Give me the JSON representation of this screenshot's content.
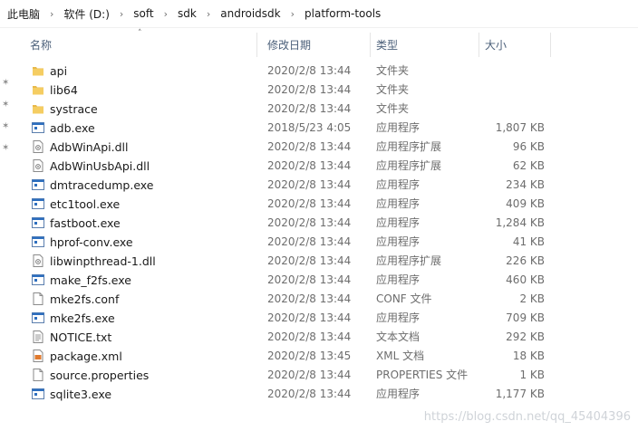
{
  "breadcrumb": [
    "此电脑",
    "软件 (D:)",
    "soft",
    "sdk",
    "androidsdk",
    "platform-tools"
  ],
  "columns": {
    "name": "名称",
    "date": "修改日期",
    "type": "类型",
    "size": "大小"
  },
  "files": [
    {
      "icon": "folder-icon",
      "name": "api",
      "date": "2020/2/8 13:44",
      "type": "文件夹",
      "size": ""
    },
    {
      "icon": "folder-icon",
      "name": "lib64",
      "date": "2020/2/8 13:44",
      "type": "文件夹",
      "size": ""
    },
    {
      "icon": "folder-icon",
      "name": "systrace",
      "date": "2020/2/8 13:44",
      "type": "文件夹",
      "size": ""
    },
    {
      "icon": "exe-icon",
      "name": "adb.exe",
      "date": "2018/5/23 4:05",
      "type": "应用程序",
      "size": "1,807 KB"
    },
    {
      "icon": "dll-icon",
      "name": "AdbWinApi.dll",
      "date": "2020/2/8 13:44",
      "type": "应用程序扩展",
      "size": "96 KB"
    },
    {
      "icon": "dll-icon",
      "name": "AdbWinUsbApi.dll",
      "date": "2020/2/8 13:44",
      "type": "应用程序扩展",
      "size": "62 KB"
    },
    {
      "icon": "exe-icon",
      "name": "dmtracedump.exe",
      "date": "2020/2/8 13:44",
      "type": "应用程序",
      "size": "234 KB"
    },
    {
      "icon": "exe-icon",
      "name": "etc1tool.exe",
      "date": "2020/2/8 13:44",
      "type": "应用程序",
      "size": "409 KB"
    },
    {
      "icon": "exe-icon",
      "name": "fastboot.exe",
      "date": "2020/2/8 13:44",
      "type": "应用程序",
      "size": "1,284 KB"
    },
    {
      "icon": "exe-icon",
      "name": "hprof-conv.exe",
      "date": "2020/2/8 13:44",
      "type": "应用程序",
      "size": "41 KB"
    },
    {
      "icon": "dll-icon",
      "name": "libwinpthread-1.dll",
      "date": "2020/2/8 13:44",
      "type": "应用程序扩展",
      "size": "226 KB"
    },
    {
      "icon": "exe-icon",
      "name": "make_f2fs.exe",
      "date": "2020/2/8 13:44",
      "type": "应用程序",
      "size": "460 KB"
    },
    {
      "icon": "file-icon",
      "name": "mke2fs.conf",
      "date": "2020/2/8 13:44",
      "type": "CONF 文件",
      "size": "2 KB"
    },
    {
      "icon": "exe-icon",
      "name": "mke2fs.exe",
      "date": "2020/2/8 13:44",
      "type": "应用程序",
      "size": "709 KB"
    },
    {
      "icon": "text-file-icon",
      "name": "NOTICE.txt",
      "date": "2020/2/8 13:44",
      "type": "文本文档",
      "size": "292 KB"
    },
    {
      "icon": "xml-file-icon",
      "name": "package.xml",
      "date": "2020/2/8 13:45",
      "type": "XML 文档",
      "size": "18 KB"
    },
    {
      "icon": "file-icon",
      "name": "source.properties",
      "date": "2020/2/8 13:44",
      "type": "PROPERTIES 文件",
      "size": "1 KB"
    },
    {
      "icon": "exe-icon",
      "name": "sqlite3.exe",
      "date": "2020/2/8 13:44",
      "type": "应用程序",
      "size": "1,177 KB"
    }
  ],
  "watermark": "https://blog.csdn.net/qq_45404396",
  "colors": {
    "folder": "#e8b94a",
    "exe_blue": "#2e6fbf",
    "header_text": "#4c607a"
  }
}
